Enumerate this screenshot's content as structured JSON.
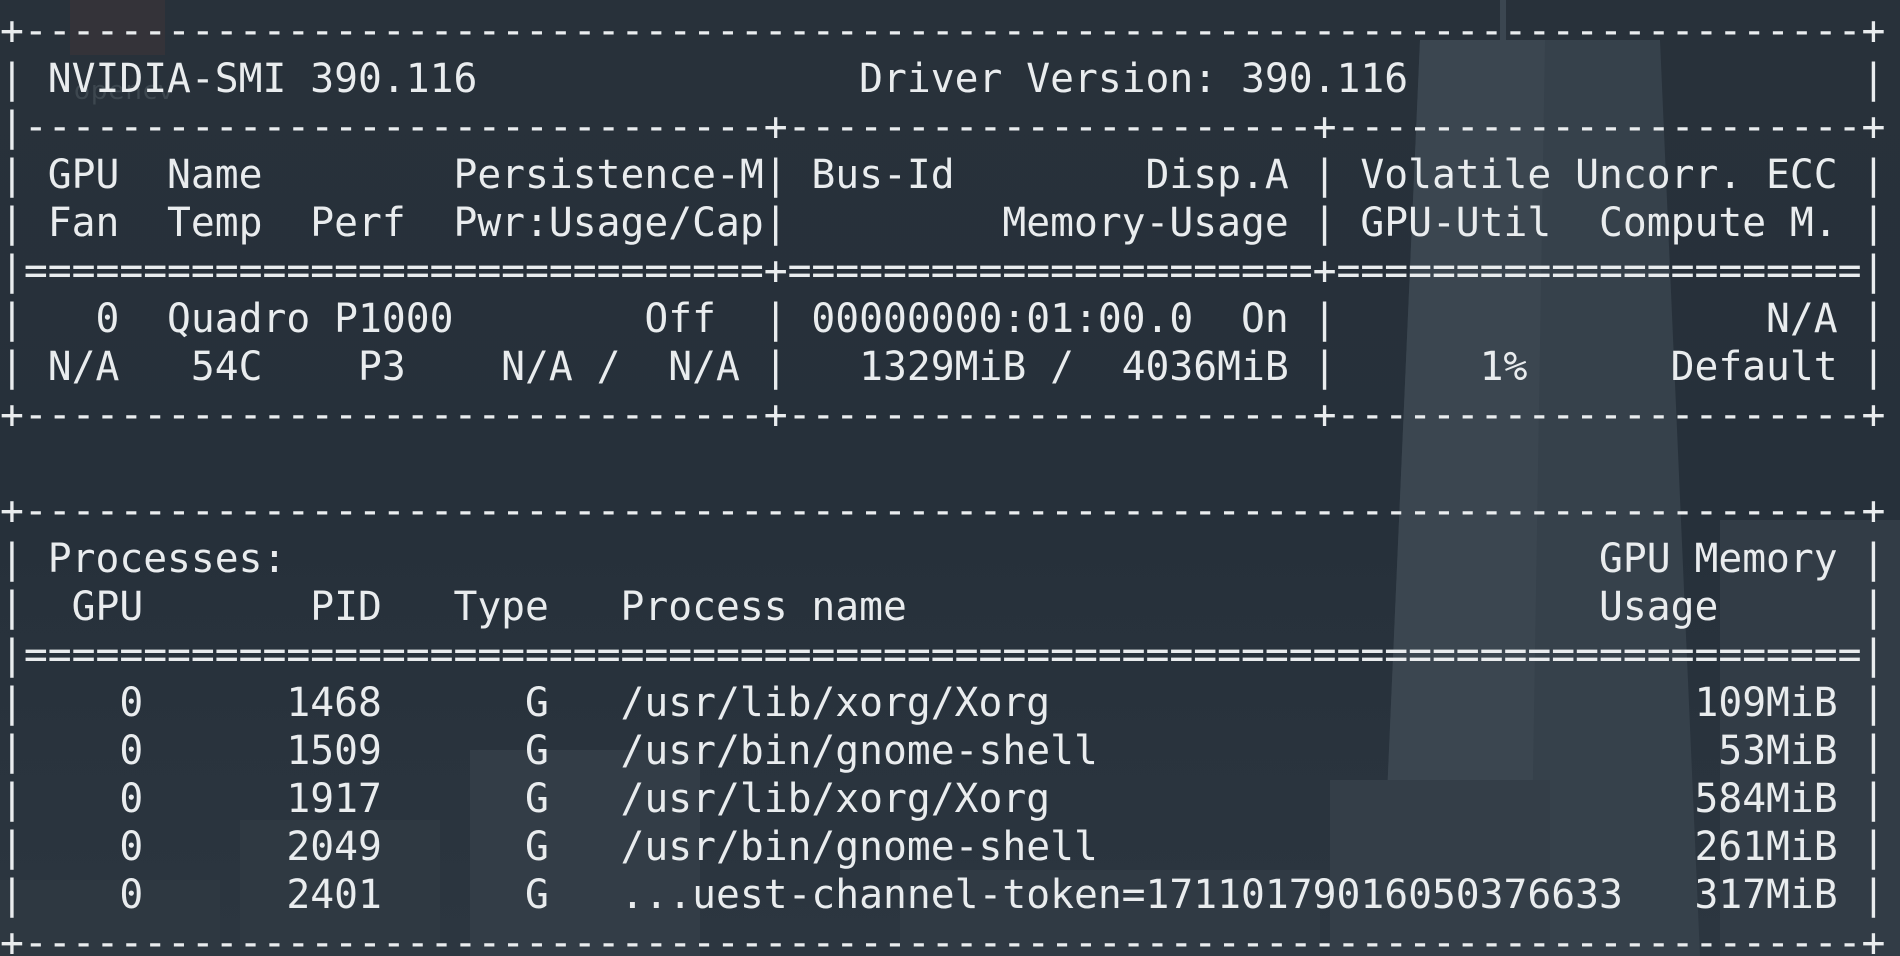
{
  "watermark": "opencv",
  "terminal": {
    "lines": [
      "+-----------------------------------------------------------------------------+",
      "| NVIDIA-SMI 390.116                Driver Version: 390.116                   |",
      "|-------------------------------+----------------------+----------------------+",
      "| GPU  Name        Persistence-M| Bus-Id        Disp.A | Volatile Uncorr. ECC |",
      "| Fan  Temp  Perf  Pwr:Usage/Cap|         Memory-Usage | GPU-Util  Compute M. |",
      "|===============================+======================+======================|",
      "|   0  Quadro P1000        Off  | 00000000:01:00.0  On |                  N/A |",
      "| N/A   54C    P3    N/A /  N/A |   1329MiB /  4036MiB |      1%      Default |",
      "+-------------------------------+----------------------+----------------------+",
      "",
      "+-----------------------------------------------------------------------------+",
      "| Processes:                                                       GPU Memory |",
      "|  GPU       PID   Type   Process name                             Usage      |",
      "|=============================================================================|",
      "|    0      1468      G   /usr/lib/xorg/Xorg                           109MiB |",
      "|    0      1509      G   /usr/bin/gnome-shell                          53MiB |",
      "|    0      1917      G   /usr/lib/xorg/Xorg                           584MiB |",
      "|    0      2049      G   /usr/bin/gnome-shell                         261MiB |",
      "|    0      2401      G   ...uest-channel-token=17110179016050376633   317MiB |",
      "+-----------------------------------------------------------------------------+"
    ]
  }
}
